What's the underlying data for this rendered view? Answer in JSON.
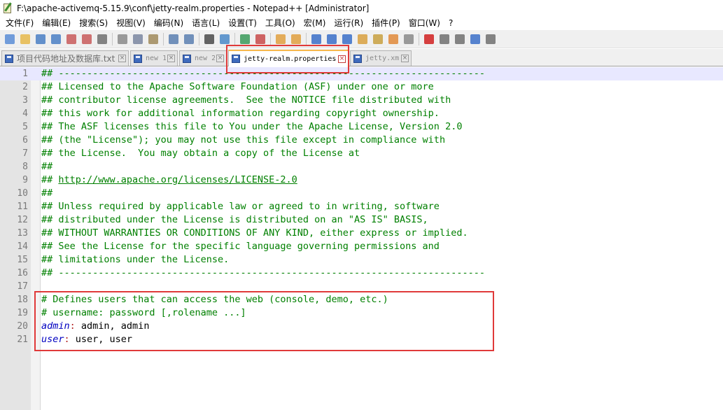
{
  "window": {
    "title": "F:\\apache-activemq-5.15.9\\conf\\jetty-realm.properties - Notepad++ [Administrator]"
  },
  "menu": [
    "文件(F)",
    "编辑(E)",
    "搜索(S)",
    "视图(V)",
    "编码(N)",
    "语言(L)",
    "设置(T)",
    "工具(O)",
    "宏(M)",
    "运行(R)",
    "插件(P)",
    "窗口(W)",
    "?"
  ],
  "toolbar": {
    "icons": [
      "new-file-icon",
      "open-file-icon",
      "save-icon",
      "save-all-icon",
      "close-icon",
      "close-all-icon",
      "print-icon",
      "cut-icon",
      "copy-icon",
      "paste-icon",
      "undo-icon",
      "redo-icon",
      "find-icon",
      "replace-icon",
      "zoom-in-icon",
      "zoom-out-icon",
      "sync-vertical-icon",
      "sync-horizontal-icon",
      "word-wrap-icon",
      "show-all-chars-icon",
      "indent-guide-icon",
      "doc-map-icon",
      "function-list-icon",
      "folder-workspace-icon",
      "monitor-icon",
      "record-macro-icon",
      "stop-macro-icon",
      "play-macro-icon",
      "run-macro-multiple-icon",
      "save-macro-icon"
    ]
  },
  "tabs": [
    {
      "label": "项目代码地址及数据库.txt",
      "active": false,
      "cjk": true
    },
    {
      "label": "new 1",
      "active": false,
      "cjk": false
    },
    {
      "label": "new 2",
      "active": false,
      "cjk": false
    },
    {
      "label": "jetty-realm.properties",
      "active": true,
      "cjk": false
    },
    {
      "label": "jetty.xml",
      "active": false,
      "cjk": false
    }
  ],
  "tab_close_glyph": "×",
  "editor": {
    "current_line": 1,
    "lines": [
      {
        "n": "1",
        "parts": [
          {
            "t": "## ---------------------------------------------------------------------------",
            "c": "comment"
          }
        ]
      },
      {
        "n": "2",
        "parts": [
          {
            "t": "## Licensed to the Apache Software Foundation (ASF) under one or more",
            "c": "comment"
          }
        ]
      },
      {
        "n": "3",
        "parts": [
          {
            "t": "## contributor license agreements.  See the NOTICE file distributed with",
            "c": "comment"
          }
        ]
      },
      {
        "n": "4",
        "parts": [
          {
            "t": "## this work for additional information regarding copyright ownership.",
            "c": "comment"
          }
        ]
      },
      {
        "n": "5",
        "parts": [
          {
            "t": "## The ASF licenses this file to You under the Apache License, Version 2.0",
            "c": "comment"
          }
        ]
      },
      {
        "n": "6",
        "parts": [
          {
            "t": "## (the \"License\"); you may not use this file except in compliance with",
            "c": "comment"
          }
        ]
      },
      {
        "n": "7",
        "parts": [
          {
            "t": "## the License.  You may obtain a copy of the License at",
            "c": "comment"
          }
        ]
      },
      {
        "n": "8",
        "parts": [
          {
            "t": "##",
            "c": "comment"
          }
        ]
      },
      {
        "n": "9",
        "parts": [
          {
            "t": "## ",
            "c": "comment"
          },
          {
            "t": "http://www.apache.org/licenses/LICENSE-2.0",
            "c": "link"
          }
        ]
      },
      {
        "n": "10",
        "parts": [
          {
            "t": "##",
            "c": "comment"
          }
        ]
      },
      {
        "n": "11",
        "parts": [
          {
            "t": "## Unless required by applicable law or agreed to in writing, software",
            "c": "comment"
          }
        ]
      },
      {
        "n": "12",
        "parts": [
          {
            "t": "## distributed under the License is distributed on an \"AS IS\" BASIS,",
            "c": "comment"
          }
        ]
      },
      {
        "n": "13",
        "parts": [
          {
            "t": "## WITHOUT WARRANTIES OR CONDITIONS OF ANY KIND, either express or implied.",
            "c": "comment"
          }
        ]
      },
      {
        "n": "14",
        "parts": [
          {
            "t": "## See the License for the specific language governing permissions and",
            "c": "comment"
          }
        ]
      },
      {
        "n": "15",
        "parts": [
          {
            "t": "## limitations under the License.",
            "c": "comment"
          }
        ]
      },
      {
        "n": "16",
        "parts": [
          {
            "t": "## ---------------------------------------------------------------------------",
            "c": "comment"
          }
        ]
      },
      {
        "n": "17",
        "parts": []
      },
      {
        "n": "18",
        "parts": [
          {
            "t": "# Defines users that can access the web (console, demo, etc.)",
            "c": "comment"
          }
        ]
      },
      {
        "n": "19",
        "parts": [
          {
            "t": "# username: password [,rolename ...]",
            "c": "comment"
          }
        ]
      },
      {
        "n": "20",
        "parts": [
          {
            "t": "admin",
            "c": "key"
          },
          {
            "t": ":",
            "c": "eq"
          },
          {
            "t": " admin, admin",
            "c": "val"
          }
        ]
      },
      {
        "n": "21",
        "parts": [
          {
            "t": "user",
            "c": "key"
          },
          {
            "t": ":",
            "c": "eq"
          },
          {
            "t": " user, user",
            "c": "val"
          }
        ]
      }
    ]
  },
  "colors": {
    "comment": "#008000",
    "key": "#0000c0",
    "operator": "#b22222",
    "highlight_box": "#e03a3a",
    "active_tab_accent": "#f7b84d"
  }
}
